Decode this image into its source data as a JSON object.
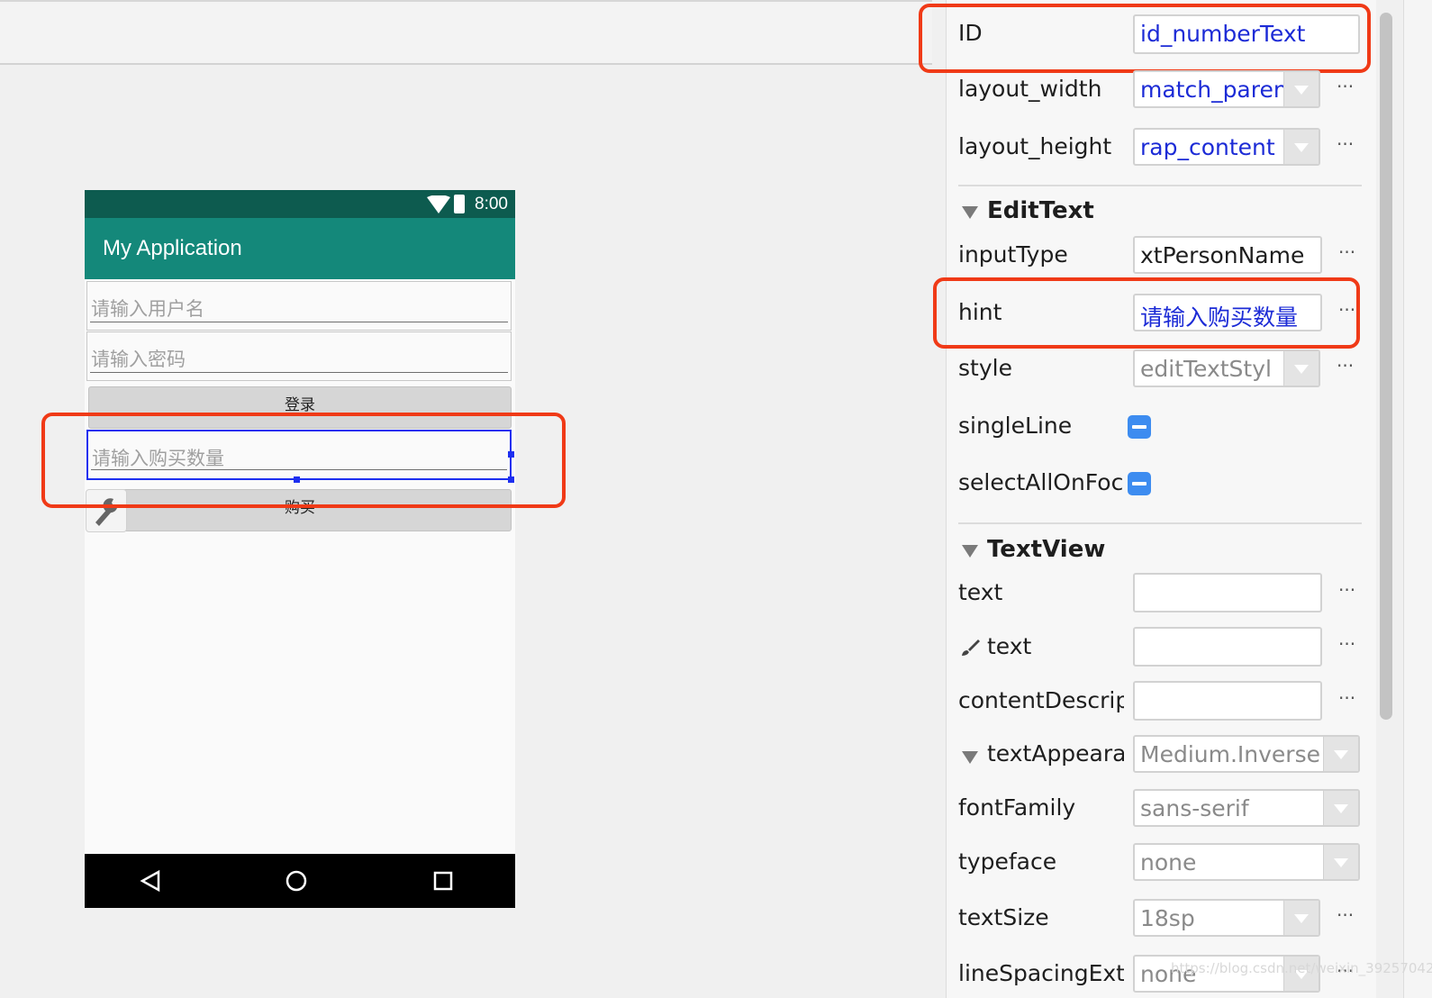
{
  "phone": {
    "status_time": "8:00",
    "app_title": "My Application",
    "username_hint": "请输入用户名",
    "password_hint": "请输入密码",
    "login_button": "登录",
    "quantity_hint": "请输入购买数量",
    "buy_button": "购买"
  },
  "attributes": {
    "id": {
      "label": "ID",
      "value": "id_numberText"
    },
    "layout_width": {
      "label": "layout_width",
      "value": "match_paren"
    },
    "layout_height": {
      "label": "layout_height",
      "value": "rap_content"
    },
    "edittext_section": "EditText",
    "input_type": {
      "label": "inputType",
      "value": "xtPersonName"
    },
    "hint": {
      "label": "hint",
      "value": "请输入购买数量"
    },
    "style": {
      "label": "style",
      "value": "editTextStyl"
    },
    "single_line": {
      "label": "singleLine"
    },
    "select_all_on_focus": {
      "label": "selectAllOnFoc"
    },
    "textview_section": "TextView",
    "text": {
      "label": "text",
      "value": ""
    },
    "design_text": {
      "label": "text",
      "value": ""
    },
    "content_description": {
      "label": "contentDescrip",
      "value": ""
    },
    "text_appearance": {
      "label": "textAppeara",
      "value": "Medium.Inverse"
    },
    "font_family": {
      "label": "fontFamily",
      "value": "sans-serif"
    },
    "typeface": {
      "label": "typeface",
      "value": "none"
    },
    "text_size": {
      "label": "textSize",
      "value": "18sp"
    },
    "line_spacing_extra": {
      "label": "lineSpacingExt",
      "value": "none"
    },
    "more": "···"
  },
  "watermark": "https://blog.csdn.net/weixin_39257042",
  "colors": {
    "highlight": "#f03a17",
    "selection": "#1d2ff0",
    "app_bar": "#14887a",
    "status_bar": "#0d5b4f",
    "value_blue": "#1c2bd6"
  }
}
